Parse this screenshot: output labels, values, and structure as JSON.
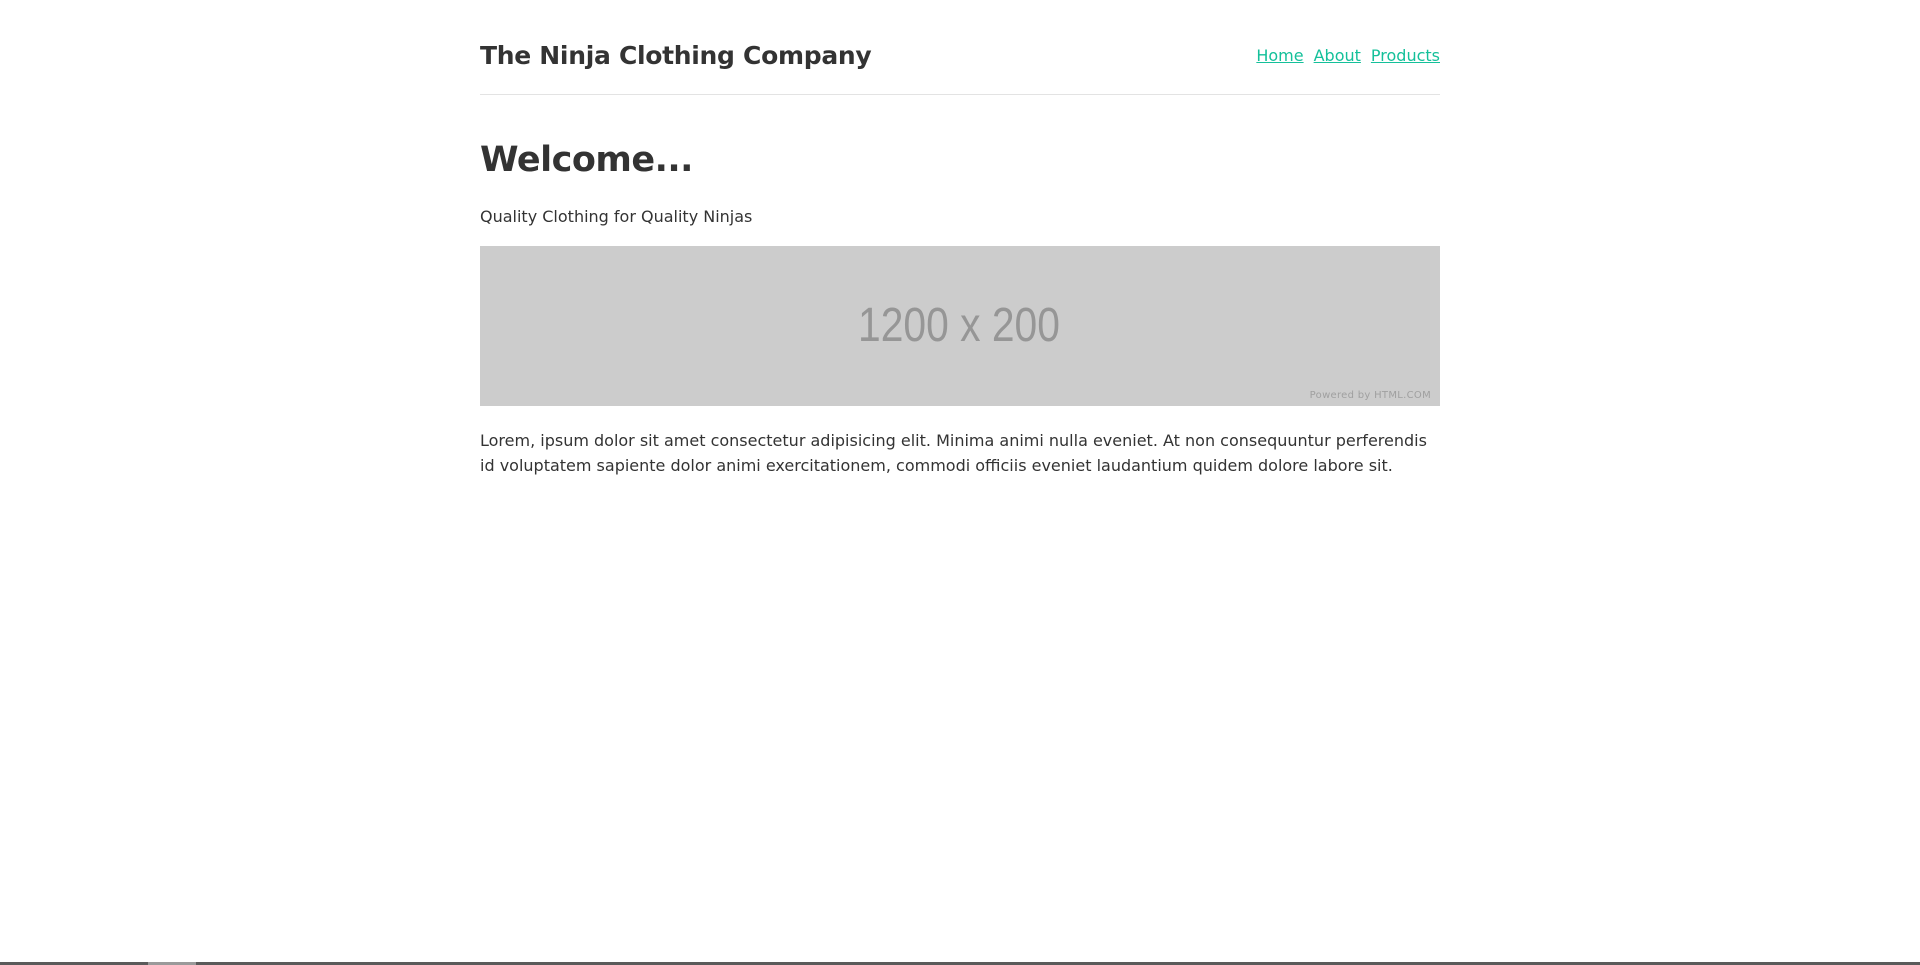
{
  "header": {
    "site_title": "The Ninja Clothing Company",
    "nav": [
      {
        "label": "Home"
      },
      {
        "label": "About"
      },
      {
        "label": "Products"
      }
    ]
  },
  "main": {
    "heading": "Welcome...",
    "subtitle": "Quality Clothing for Quality Ninjas",
    "banner": {
      "placeholder_text": "1200 x 200",
      "credit": "Powered by HTML.COM"
    },
    "paragraph": "Lorem, ipsum dolor sit amet consectetur adipisicing elit. Minima animi nulla eveniet. At non consequuntur perferendis id voluptatem sapiente dolor animi exercitationem, commodi officiis eveniet laudantium quidem dolore labore sit."
  },
  "colors": {
    "link": "#14c09a",
    "text": "#333333",
    "banner_bg": "#cccccc",
    "divider": "#e3e3e3"
  }
}
